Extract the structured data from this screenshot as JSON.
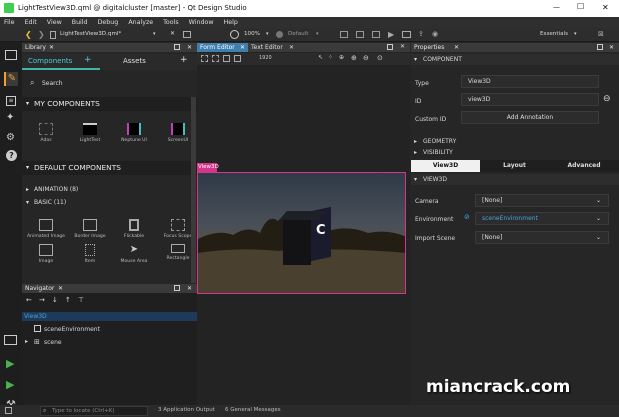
{
  "window": {
    "title": "LightTestView3D.qml @ digitalcluster [master] - Qt Design Studio",
    "minimize": "—",
    "maximize": "☐",
    "close": "✕"
  },
  "menu": [
    "File",
    "Edit",
    "View",
    "Build",
    "Debug",
    "Analyze",
    "Tools",
    "Window",
    "Help"
  ],
  "toolbar": {
    "file_tab": "LightTestView3D.qml*",
    "zoom": "100%",
    "style": "Default",
    "workspace": "Essentials"
  },
  "library": {
    "title": "Library",
    "tabs": [
      "Components",
      "Assets"
    ],
    "search_placeholder": "Search",
    "my_components_header": "MY COMPONENTS",
    "my_components": [
      "Adas",
      "LightTest",
      "Neptune UI",
      "ScreenUI"
    ],
    "default_components_header": "DEFAULT COMPONENTS",
    "categories": [
      "ANIMATION (8)",
      "BASIC (11)"
    ],
    "basic_items": [
      "Animated Image",
      "Border Image",
      "Flickable",
      "Focus Scope",
      "Image",
      "Item",
      "Mouse Area",
      "Rectangle"
    ]
  },
  "editor": {
    "tabs": [
      "Form Editor",
      "Text Editor"
    ],
    "zoom_value": "1920",
    "view_label": "View3D",
    "cube_letter": "C"
  },
  "navigator": {
    "title": "Navigator",
    "root": "View3D",
    "items": [
      "sceneEnvironment",
      "scene"
    ]
  },
  "properties": {
    "title": "Properties",
    "component_header": "COMPONENT",
    "type_label": "Type",
    "type_value": "View3D",
    "id_label": "ID",
    "id_value": "view3D",
    "custom_id_label": "Custom ID",
    "add_annotation": "Add Annotation",
    "geometry": "GEOMETRY",
    "visibility": "VISIBILITY",
    "tabs": [
      "View3D",
      "Layout",
      "Advanced"
    ],
    "view3d_header": "VIEW3D",
    "camera_label": "Camera",
    "camera_value": "[None]",
    "environment_label": "Environment",
    "environment_value": "sceneEnvironment",
    "import_scene_label": "Import Scene",
    "import_scene_value": "[None]"
  },
  "statusbar": {
    "locate_placeholder": "Type to locate (Ctrl+K)",
    "items": [
      "3  Application Output",
      "6  General Messages"
    ]
  },
  "watermark": "miancrack.com",
  "colors": {
    "accent_teal": "#3fb5a8",
    "selection_pink": "#d6338a",
    "link_blue": "#4aa3df",
    "brand_green": "#4caf50"
  }
}
